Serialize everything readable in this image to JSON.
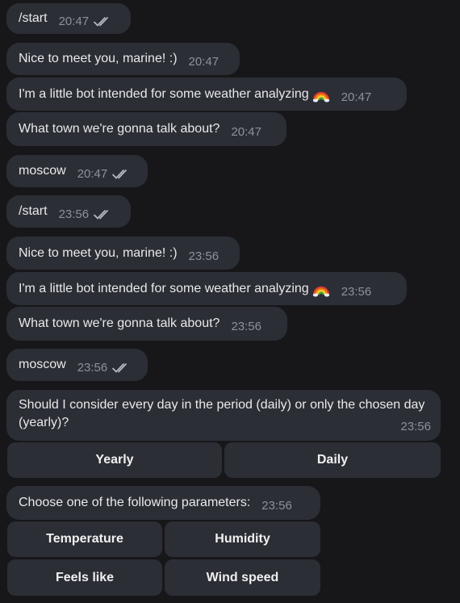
{
  "messages": [
    {
      "text": "/start",
      "time": "20:47"
    },
    {
      "text": "Nice to meet you, marine! :)",
      "time": "20:47"
    },
    {
      "text": "I'm a little bot intended for some weather analyzing",
      "time": "20:47"
    },
    {
      "text": "What town we're gonna talk about?",
      "time": "20:47"
    },
    {
      "text": "moscow",
      "time": "20:47"
    },
    {
      "text": "/start",
      "time": "23:56"
    },
    {
      "text": "Nice to meet you, marine! :)",
      "time": "23:56"
    },
    {
      "text": "I'm a little bot intended for some weather analyzing",
      "time": "23:56"
    },
    {
      "text": "What town we're gonna talk about?",
      "time": "23:56"
    },
    {
      "text": "moscow",
      "time": "23:56"
    },
    {
      "text": "Should I consider every day in the period (daily) or only the chosen day (yearly)?",
      "time": "23:56"
    },
    {
      "text": "Choose one of the following parameters:",
      "time": "23:56"
    }
  ],
  "keyboards": {
    "period": {
      "yearly": "Yearly",
      "daily": "Daily"
    },
    "parameters": {
      "temperature": "Temperature",
      "humidity": "Humidity",
      "feels_like": "Feels like",
      "wind_speed": "Wind speed"
    }
  },
  "icons": {
    "read_receipt": "double-check-icon",
    "emoji": "rainbow-emoji"
  }
}
